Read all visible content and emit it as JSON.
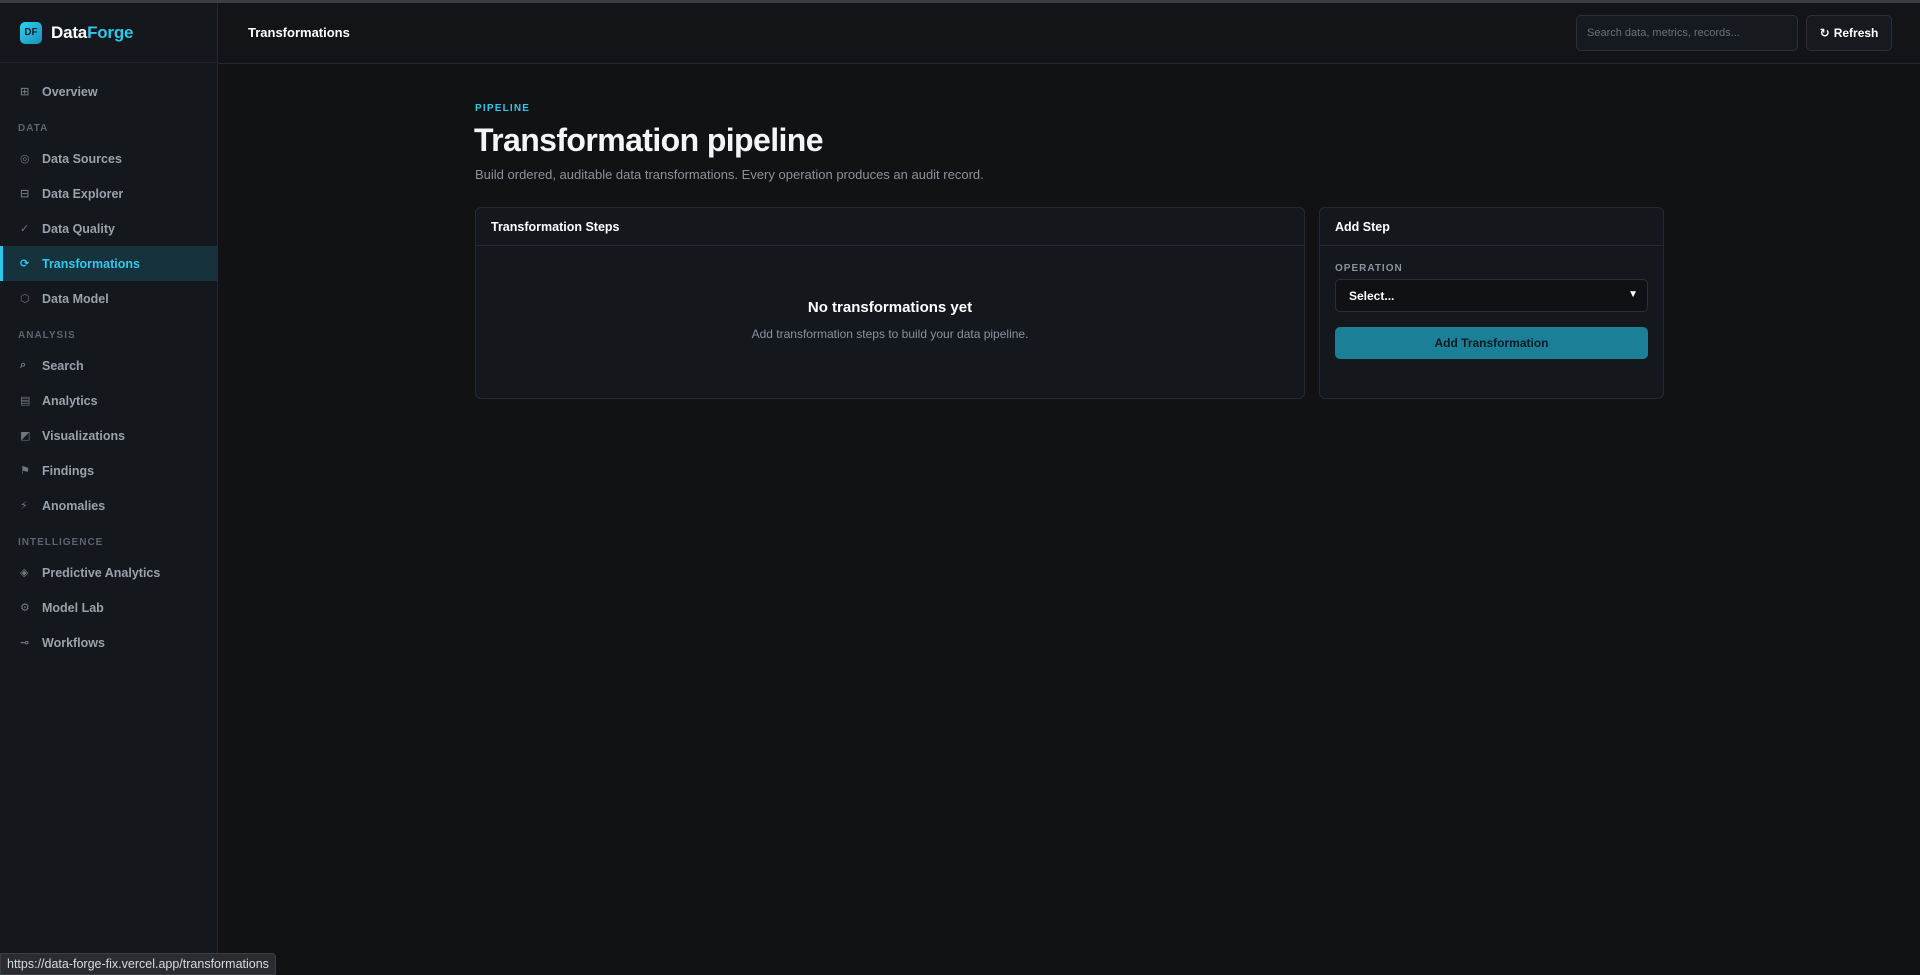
{
  "brand": {
    "badge": "DF",
    "name_part1": "Data",
    "name_part2": "Forge"
  },
  "sidebar": {
    "top_items": [
      {
        "label": "Overview",
        "icon": "grid-icon",
        "glyph": "⊞"
      }
    ],
    "sections": [
      {
        "title": "DATA",
        "items": [
          {
            "label": "Data Sources",
            "icon": "target-icon",
            "glyph": "◎"
          },
          {
            "label": "Data Explorer",
            "icon": "table-icon",
            "glyph": "⊟"
          },
          {
            "label": "Data Quality",
            "icon": "check-icon",
            "glyph": "✓"
          },
          {
            "label": "Transformations",
            "icon": "refresh-cycle-icon",
            "glyph": "⟳",
            "active": true
          },
          {
            "label": "Data Model",
            "icon": "hexagon-icon",
            "glyph": "⬡"
          }
        ]
      },
      {
        "title": "ANALYSIS",
        "items": [
          {
            "label": "Search",
            "icon": "search-icon",
            "glyph": "⌕"
          },
          {
            "label": "Analytics",
            "icon": "bars-icon",
            "glyph": "▤"
          },
          {
            "label": "Visualizations",
            "icon": "chart-icon",
            "glyph": "◩"
          },
          {
            "label": "Findings",
            "icon": "flag-icon",
            "glyph": "⚑"
          },
          {
            "label": "Anomalies",
            "icon": "lightning-icon",
            "glyph": "⚡"
          }
        ]
      },
      {
        "title": "INTELLIGENCE",
        "items": [
          {
            "label": "Predictive Analytics",
            "icon": "diamond-icon",
            "glyph": "◈"
          },
          {
            "label": "Model Lab",
            "icon": "gear-icon",
            "glyph": "⚙"
          },
          {
            "label": "Workflows",
            "icon": "arrow-icon",
            "glyph": "⊸"
          }
        ]
      }
    ]
  },
  "header": {
    "title": "Transformations",
    "search_placeholder": "Search data, metrics, records...",
    "refresh_label": "Refresh",
    "refresh_glyph": "↻"
  },
  "main": {
    "eyebrow": "PIPELINE",
    "title": "Transformation pipeline",
    "subtitle": "Build ordered, auditable data transformations. Every operation produces an audit record.",
    "steps_card": {
      "title": "Transformation Steps",
      "empty_title": "No transformations yet",
      "empty_sub": "Add transformation steps to build your data pipeline."
    },
    "add_card": {
      "title": "Add Step",
      "operation_label": "OPERATION",
      "operation_value": "Select...",
      "button_label": "Add Transformation"
    }
  },
  "statusbar": {
    "url": "https://data-forge-fix.vercel.app/transformations"
  },
  "colors": {
    "accent": "#2ec7ea",
    "button": "#1c7f98",
    "background": "#111214",
    "sidebar": "#14171c"
  }
}
